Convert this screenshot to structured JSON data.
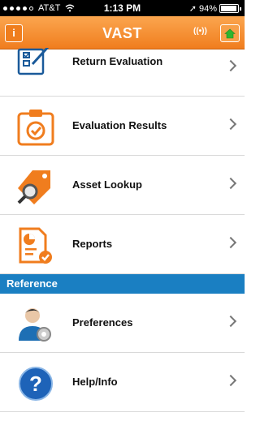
{
  "status_bar": {
    "carrier": "AT&T",
    "time": "1:13 PM",
    "battery": "94%",
    "battery_level": 0.94,
    "location_arrow": "➚"
  },
  "nav_bar": {
    "title": "VAST",
    "info_glyph": "i",
    "signal_glyph": "((•))"
  },
  "menu": {
    "items": [
      {
        "label": "Return Evaluation",
        "icon": "return-evaluation-icon"
      },
      {
        "label": "Evaluation Results",
        "icon": "clipboard-check-icon"
      },
      {
        "label": "Asset Lookup",
        "icon": "tag-magnifier-icon"
      },
      {
        "label": "Reports",
        "icon": "report-chart-icon"
      }
    ]
  },
  "reference": {
    "header": "Reference",
    "items": [
      {
        "label": "Preferences",
        "icon": "user-gear-icon"
      },
      {
        "label": "Help/Info",
        "icon": "help-question-icon"
      }
    ]
  },
  "colors": {
    "accent_orange": "#f07d1e",
    "section_blue": "#1a7fc2",
    "home_green": "#2fb52f"
  }
}
